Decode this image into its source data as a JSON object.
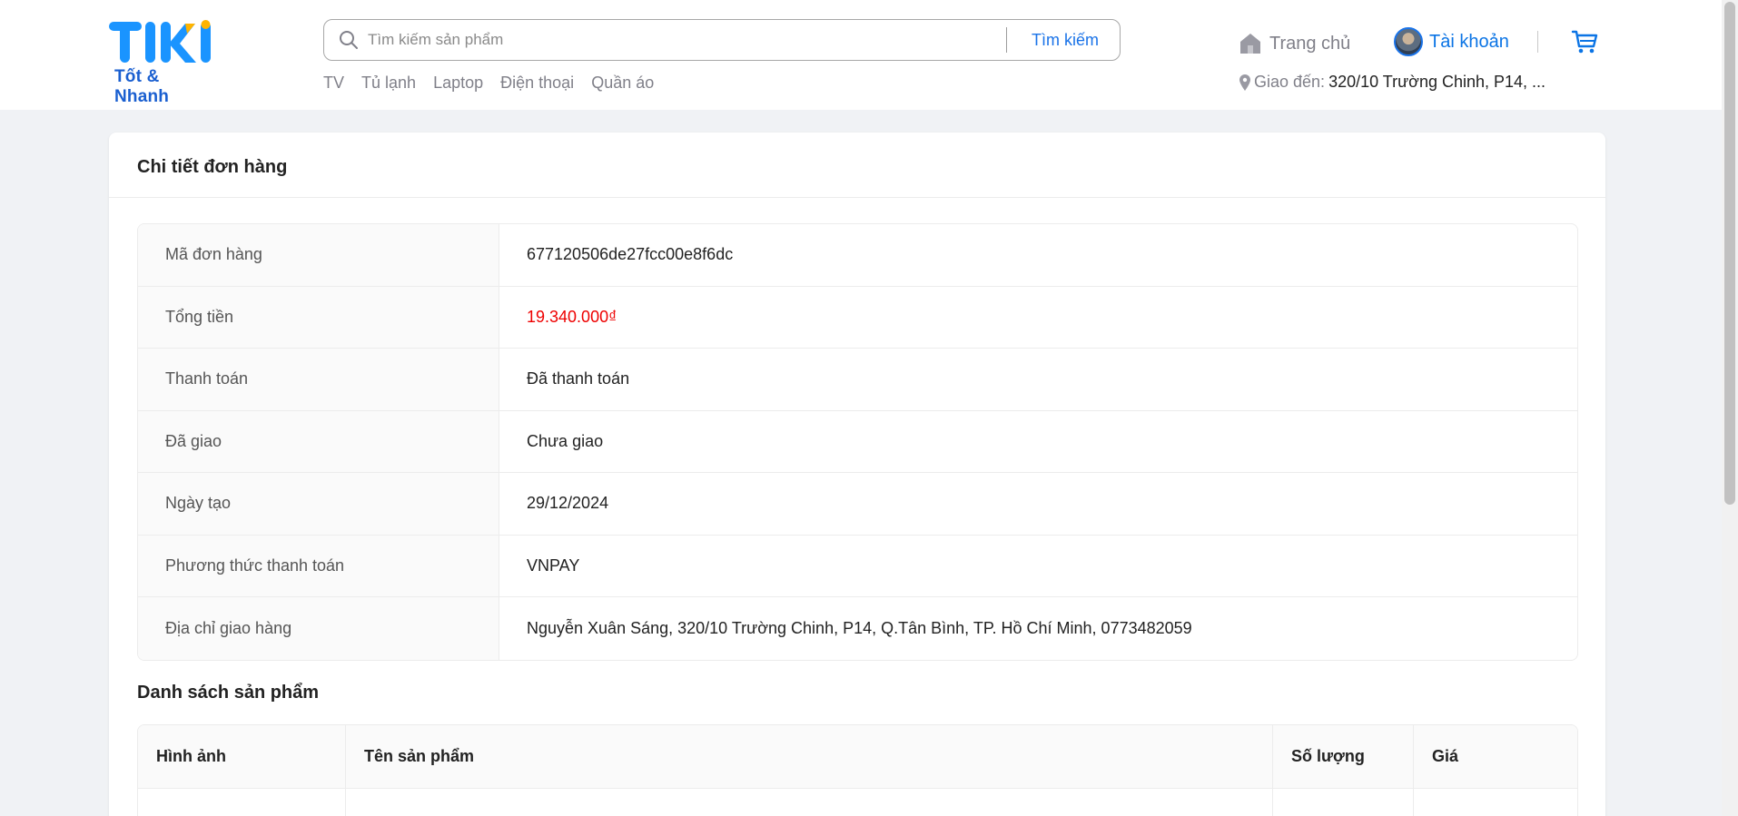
{
  "header": {
    "logo_text": "TIKI",
    "logo_tagline": "Tốt & Nhanh",
    "search": {
      "placeholder": "Tìm kiếm sản phẩm",
      "value": "",
      "button_label": "Tìm kiếm"
    },
    "quick_links": [
      "TV",
      "Tủ lạnh",
      "Laptop",
      "Điện thoại",
      "Quần áo"
    ],
    "nav": {
      "home_label": "Trang chủ",
      "account_label": "Tài khoản"
    },
    "delivery": {
      "label": "Giao đến:",
      "address": "320/10 Trường Chinh, P14, ..."
    },
    "colors": {
      "brand": "#1a94ff",
      "link": "#0b74e5",
      "logo_accent": "#ffb400"
    }
  },
  "order": {
    "title": "Chi tiết đơn hàng",
    "rows": [
      {
        "label": "Mã đơn hàng",
        "value": "677120506de27fcc00e8f6dc"
      },
      {
        "label": "Tổng tiền",
        "value": "19.340.000₫"
      },
      {
        "label": "Thanh toán",
        "value": "Đã thanh toán"
      },
      {
        "label": "Đã giao",
        "value": "Chưa giao"
      },
      {
        "label": "Ngày tạo",
        "value": "29/12/2024"
      },
      {
        "label": "Phương thức thanh toán",
        "value": "VNPAY"
      },
      {
        "label": "Địa chỉ giao hàng",
        "value": "Nguyễn Xuân Sáng, 320/10 Trường Chinh, P14, Q.Tân Bình, TP. Hồ Chí Minh, 0773482059"
      }
    ],
    "price_color": "#ee0000"
  },
  "products": {
    "title": "Danh sách sản phẩm",
    "columns": [
      "Hình ảnh",
      "Tên sản phẩm",
      "Số lượng",
      "Giá"
    ]
  }
}
